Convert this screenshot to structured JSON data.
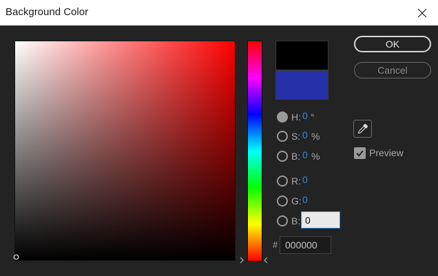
{
  "window": {
    "title": "Background Color"
  },
  "colors": {
    "new_swatch": "#000000",
    "old_swatch": "#2630a8",
    "accent": "#2d8ceb",
    "field_hue": "#ff0000"
  },
  "icons": {
    "close": "close-icon",
    "eyedropper": "eyedropper-icon",
    "checkbox": "checkbox-checked-icon",
    "field_cursor": "circle-cursor-icon"
  },
  "fields": {
    "h": {
      "label": "H:",
      "value": "0",
      "unit": "°",
      "selected": true
    },
    "s": {
      "label": "S:",
      "value": "0",
      "unit": "%"
    },
    "bri": {
      "label": "B:",
      "value": "0",
      "unit": "%"
    },
    "r": {
      "label": "R:",
      "value": "0"
    },
    "g": {
      "label": "G:",
      "value": "0"
    },
    "b": {
      "label": "B:",
      "value": "0"
    }
  },
  "hex": {
    "symbol": "#",
    "value": "000000"
  },
  "buttons": {
    "ok": "OK",
    "cancel": "Cancel"
  },
  "preview": {
    "label": "Preview",
    "checked": true
  }
}
